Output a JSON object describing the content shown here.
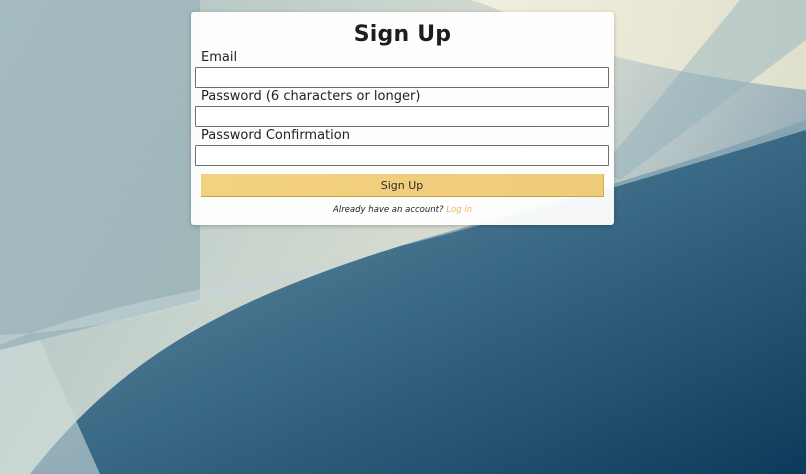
{
  "page": {
    "title": "Sign Up"
  },
  "form": {
    "email_label": "Email",
    "email_value": "",
    "password_label": "Password (6 characters or longer)",
    "password_value": "",
    "confirmation_label": "Password Confirmation",
    "confirmation_value": "",
    "submit_label": "Sign Up"
  },
  "footer": {
    "prompt_text": "Already have an account?",
    "login_link": "Log in"
  },
  "colors": {
    "button": "#f0cd79",
    "link": "#f0b45a",
    "background_dark": "#0e3d5c"
  }
}
